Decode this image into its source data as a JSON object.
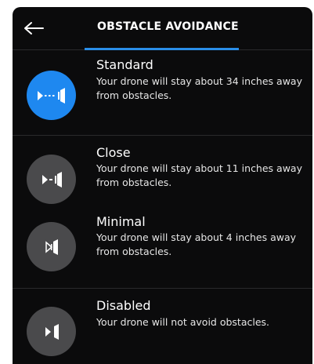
{
  "header": {
    "title": "OBSTACLE AVOIDANCE",
    "back_icon": "arrow-left-icon",
    "accent_color": "#2a8ee8"
  },
  "options": [
    {
      "title": "Standard",
      "description": "Your drone will stay about 34 inches away from obstacles.",
      "icon": "standard-avoidance-icon",
      "selected": true
    },
    {
      "title": "Close",
      "description": "Your drone will stay about 11 inches away from obstacles.",
      "icon": "close-avoidance-icon",
      "selected": false
    },
    {
      "title": "Minimal",
      "description": "Your drone will stay about 4 inches away from obstacles.",
      "icon": "minimal-avoidance-icon",
      "selected": false
    },
    {
      "title": "Disabled",
      "description": "Your drone will not avoid obstacles.",
      "icon": "disabled-avoidance-icon",
      "selected": false
    }
  ],
  "colors": {
    "selected": "#1e88f0",
    "unselected": "#4a4a4c",
    "background": "#0b0b0c"
  }
}
